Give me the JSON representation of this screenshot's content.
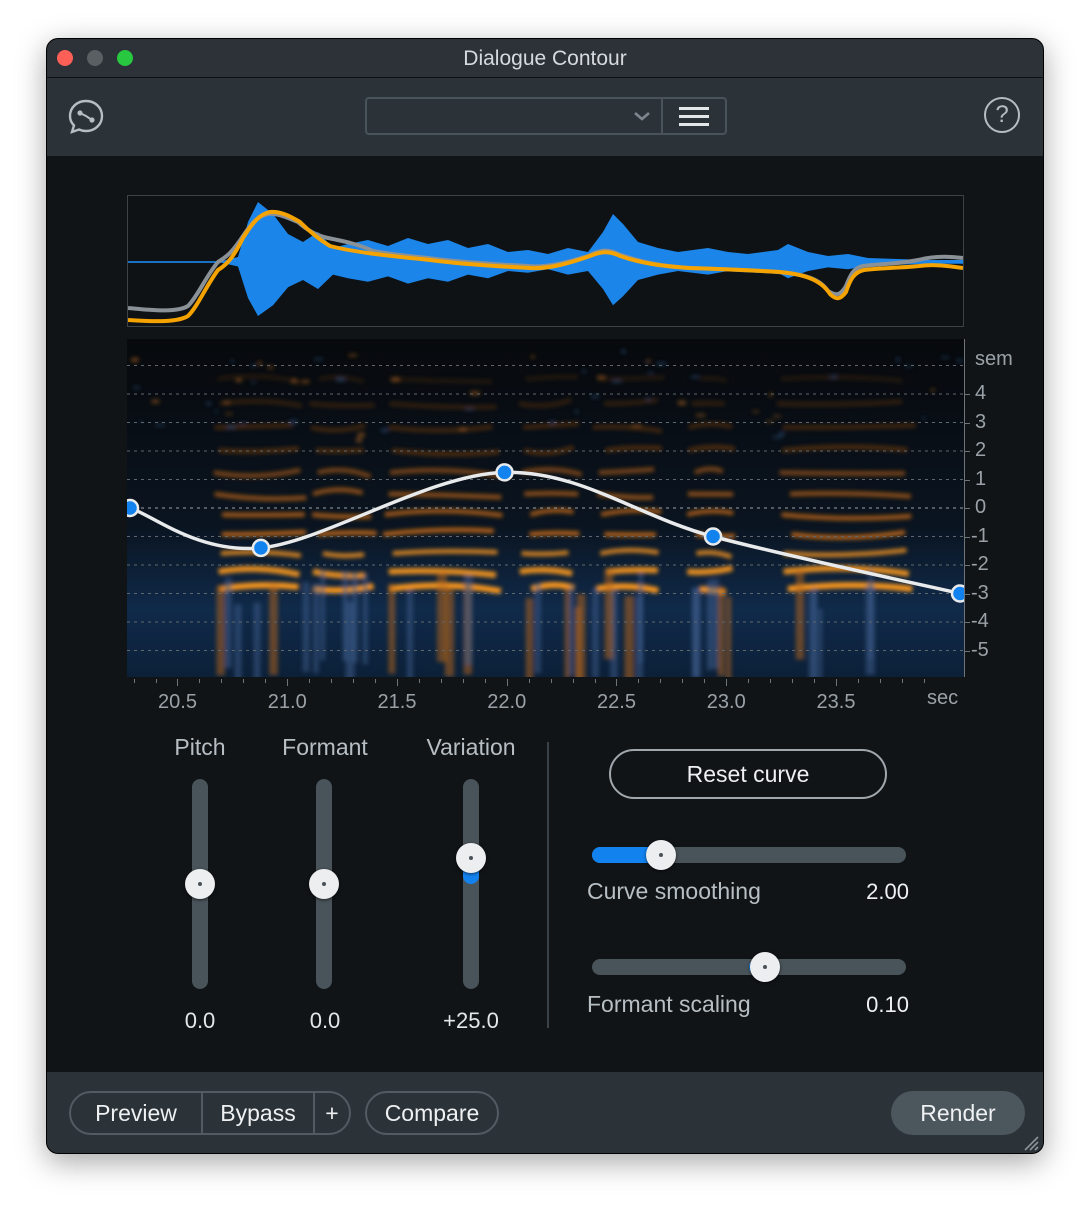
{
  "window": {
    "title": "Dialogue Contour"
  },
  "toolbar": {
    "preset_value": "",
    "logo_icon": "dialogue-contour-logo-icon",
    "menu_icon": "hamburger-menu-icon",
    "help_label": "?"
  },
  "display": {
    "y_unit": "sem",
    "y_ticks": [
      "4",
      "3",
      "2",
      "1",
      "0",
      "-1",
      "-2",
      "-3",
      "-4",
      "-5"
    ],
    "x_unit": "sec",
    "x_ticks": [
      "20.5",
      "21.0",
      "21.5",
      "22.0",
      "22.5",
      "23.0",
      "23.5"
    ],
    "curve_points": [
      {
        "t": 20.27,
        "sem": 0.0
      },
      {
        "t": 20.88,
        "sem": -1.4
      },
      {
        "t": 21.99,
        "sem": 1.25
      },
      {
        "t": 22.94,
        "sem": -1.0
      },
      {
        "t": 24.07,
        "sem": -3.0
      }
    ],
    "colors": {
      "waveform": "#1e90ff",
      "pitch_original": "#8a9298",
      "pitch_corrected": "#f5a300",
      "curve": "#e8eaeb",
      "node": "#1282ef"
    }
  },
  "controls": {
    "pitch": {
      "label": "Pitch",
      "value": "0.0",
      "level": 0.5
    },
    "formant": {
      "label": "Formant",
      "value": "0.0",
      "level": 0.5
    },
    "variation": {
      "label": "Variation",
      "value": "+25.0",
      "level": 0.625
    },
    "reset_label": "Reset curve",
    "curve_smoothing": {
      "label": "Curve smoothing",
      "value": "2.00",
      "level": 0.22
    },
    "formant_scaling": {
      "label": "Formant scaling",
      "value": "0.10",
      "level": 0.55
    }
  },
  "footer": {
    "preview": "Preview",
    "bypass": "Bypass",
    "plus": "+",
    "compare": "Compare",
    "render": "Render"
  }
}
